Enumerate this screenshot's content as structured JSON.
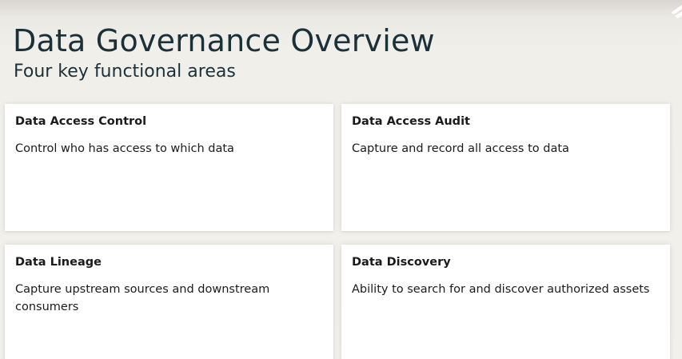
{
  "slide": {
    "title": "Data Governance Overview",
    "subtitle": "Four key functional areas"
  },
  "cards": [
    {
      "title": "Data Access Control",
      "body": "Control who has access to which data"
    },
    {
      "title": "Data Access Audit",
      "body": "Capture and record all access to data"
    },
    {
      "title": "Data Lineage",
      "body": "Capture upstream sources and downstream consumers"
    },
    {
      "title": "Data Discovery",
      "body": "Ability to search for and discover authorized assets"
    }
  ],
  "colors": {
    "heading": "#1b3139",
    "card_background": "#ffffff",
    "slide_background": "#f2f0eb"
  },
  "icons": {
    "corner": "corner-logo-icon"
  }
}
